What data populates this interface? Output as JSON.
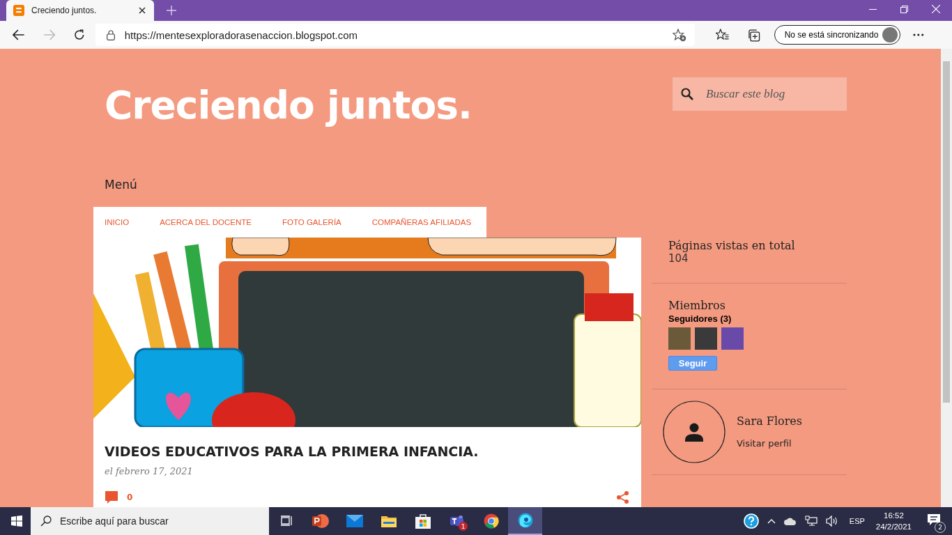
{
  "browser": {
    "tabs": [
      {
        "title": "Creciendo juntos.",
        "selected": true
      }
    ],
    "address": "https://mentesexploradorasenaccion.blogspot.com",
    "forward_disabled": true,
    "profile_label": "No se está sincronizando"
  },
  "blog": {
    "title": "Creciendo juntos.",
    "search": {
      "placeholder": "Buscar este blog"
    },
    "menu_label": "Menú",
    "nav": [
      "INICIO",
      "ACERCA DEL DOCENTE",
      "FOTO GALERÍA",
      "COMPAÑERAS AFILIADAS"
    ],
    "post": {
      "title": "VIDEOS EDUCATIVOS PARA LA PRIMERA INFANCIA.",
      "date": "el febrero 17, 2021",
      "comments": "0"
    }
  },
  "sidebar": {
    "pageviews": {
      "title": "Páginas vistas en total",
      "count": "104"
    },
    "members": {
      "title": "Miembros",
      "followers_label": "Seguidores (3)",
      "follow_button": "Seguir"
    },
    "profile": {
      "name": "Sara Flores",
      "link": "Visitar perfil"
    }
  },
  "taskbar": {
    "search_placeholder": "Escribe aquí para buscar",
    "apps": [
      {
        "kind": "taskview",
        "selected": false
      },
      {
        "kind": "powerpoint",
        "selected": false
      },
      {
        "kind": "mail",
        "selected": false
      },
      {
        "kind": "files",
        "selected": false
      },
      {
        "kind": "store",
        "selected": false
      },
      {
        "kind": "teams",
        "selected": false,
        "badge": "1"
      },
      {
        "kind": "chrome",
        "selected": false
      },
      {
        "kind": "edge",
        "selected": true
      }
    ],
    "language": "ESP",
    "time": "16:52",
    "date": "24/2/2021",
    "notifications": "2"
  }
}
